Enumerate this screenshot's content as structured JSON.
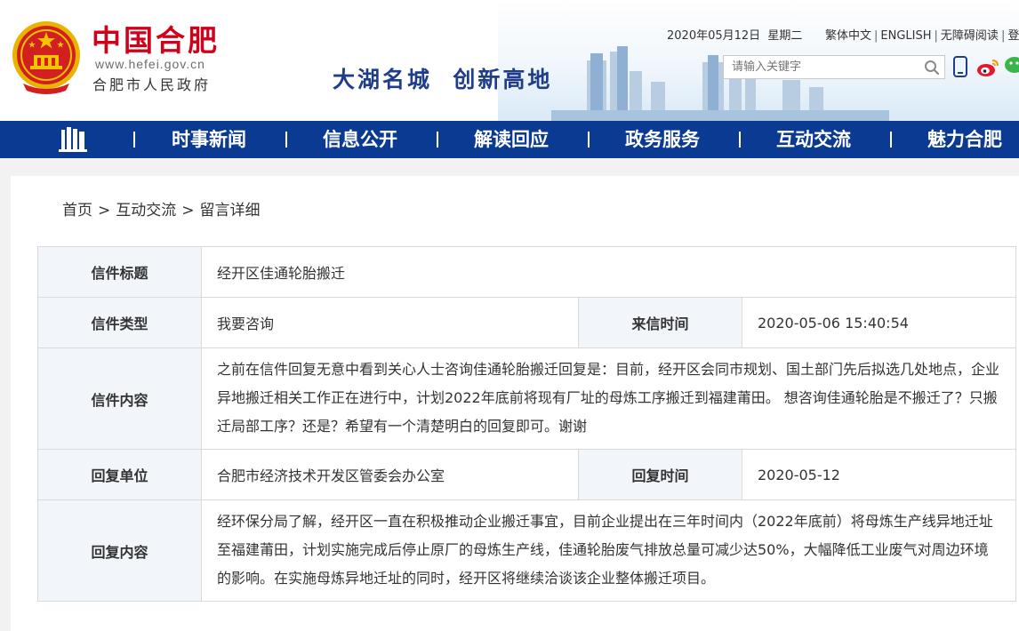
{
  "header": {
    "site_name": "中国合肥",
    "site_url": "www.hefei.gov.cn",
    "site_gov": "合肥市人民政府",
    "slogan": "大湖名城  创新高地",
    "date": "2020年05月12日  星期二",
    "links": [
      "繁体中文",
      "ENGLISH",
      "无障碍阅读",
      "登"
    ],
    "search_placeholder": "请输入关键字",
    "icons": [
      "emblem-icon",
      "search-icon",
      "mobile-icon",
      "weibo-icon",
      "wechat-icon"
    ]
  },
  "nav": {
    "home_icon": "building-icon",
    "items": [
      "时事新闻",
      "信息公开",
      "解读回应",
      "政务服务",
      "互动交流",
      "魅力合肥"
    ]
  },
  "breadcrumb": [
    "首页",
    "互动交流",
    "留言详细"
  ],
  "letter": {
    "title_label": "信件标题",
    "title": "经开区佳通轮胎搬迁",
    "type_label": "信件类型",
    "type": "我要咨询",
    "time_label": "来信时间",
    "time": "2020-05-06 15:40:54",
    "content_label": "信件内容",
    "content": "之前在信件回复无意中看到关心人士咨询佳通轮胎搬迁回复是：目前，经开区会同市规划、国土部门先后拟选几处地点，企业异地搬迁相关工作正在进行中，计划2022年底前将现有厂址的母炼工序搬迁到福建莆田。 想咨询佳通轮胎是不搬迁了？只搬迁局部工序？还是？希望有一个清楚明白的回复即可。谢谢",
    "reply_unit_label": "回复单位",
    "reply_unit": "合肥市经济技术开发区管委会办公室",
    "reply_time_label": "回复时间",
    "reply_time": "2020-05-12",
    "reply_content_label": "回复内容",
    "reply_content": "经环保分局了解，经开区一直在积极推动企业搬迁事宜，目前企业提出在三年时间内（2022年底前）将母炼生产线异地迁址至福建莆田，计划实施完成后停止原厂的母炼生产线，佳通轮胎废气排放总量可减少达50%，大幅降低工业废气对周边环境的影响。在实施母炼异地迁址的同时，经开区将继续洽谈该企业整体搬迁项目。"
  },
  "colors": {
    "nav_bg": "#0a3a92",
    "brand_red": "#d0021b",
    "label_text": "#1f4c9b",
    "label_bg": "#f2f6fb"
  }
}
